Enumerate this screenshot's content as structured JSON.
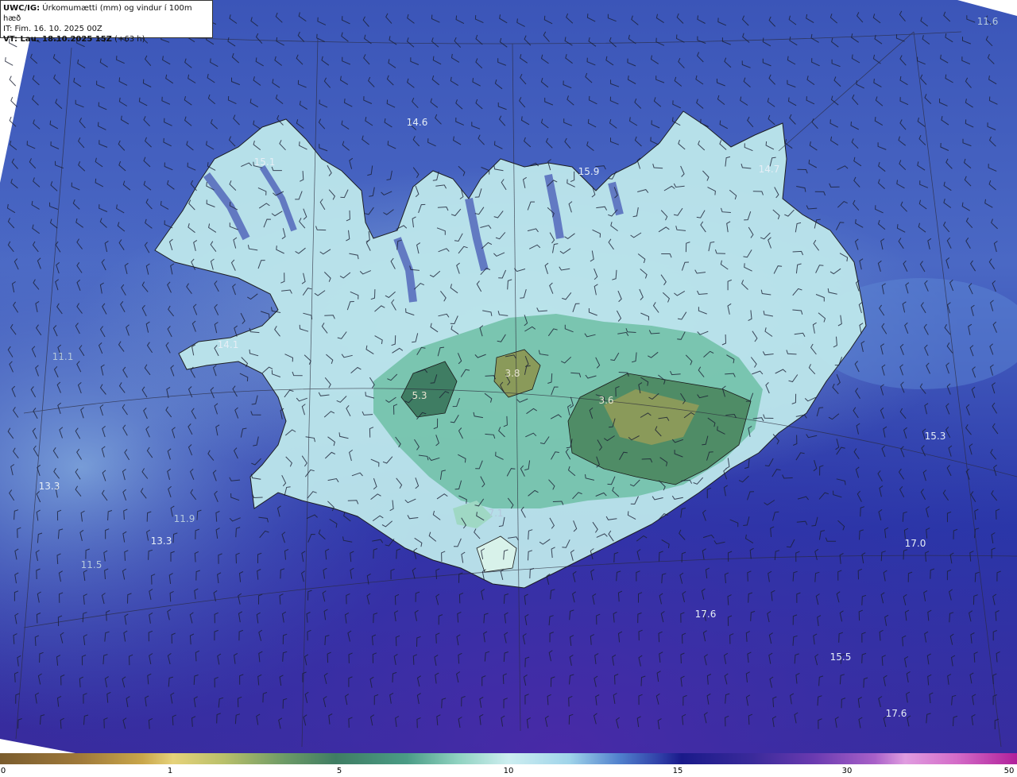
{
  "header": {
    "model": "UWC/IG:",
    "title": "Úrkomumætti (mm) og vindur í 100m hæð",
    "initial_time": "IT: Fim. 16. 10. 2025 00Z",
    "valid_label": "VT: Lau. 18.10.2025 15Z",
    "valid_offset": "(+63 h)"
  },
  "value_labels": [
    {
      "text": "11.6"
    },
    {
      "text": "14.6"
    },
    {
      "text": "15.1"
    },
    {
      "text": "15.9"
    },
    {
      "text": "14.7"
    },
    {
      "text": "11.1"
    },
    {
      "text": "14.1"
    },
    {
      "text": "3.8"
    },
    {
      "text": "5.3"
    },
    {
      "text": "3.6"
    },
    {
      "text": "15.3"
    },
    {
      "text": "13.3"
    },
    {
      "text": "11.9"
    },
    {
      "text": "13.3"
    },
    {
      "text": "11.5"
    },
    {
      "text": "7.1"
    },
    {
      "text": "17.0"
    },
    {
      "text": "17.6"
    },
    {
      "text": "15.5"
    },
    {
      "text": "17.6"
    }
  ],
  "colorbar": {
    "ticks": [
      "0",
      "1",
      "5",
      "10",
      "15",
      "30",
      "50"
    ]
  },
  "colors": {
    "ocean_deep": "#1e1a8c",
    "ocean": "#2f4fb8",
    "coast_light": "#bfe6ef",
    "land_mid": "#5fb39c",
    "land_high": "#8a9a5a",
    "coastline": "#1a1a1a"
  }
}
